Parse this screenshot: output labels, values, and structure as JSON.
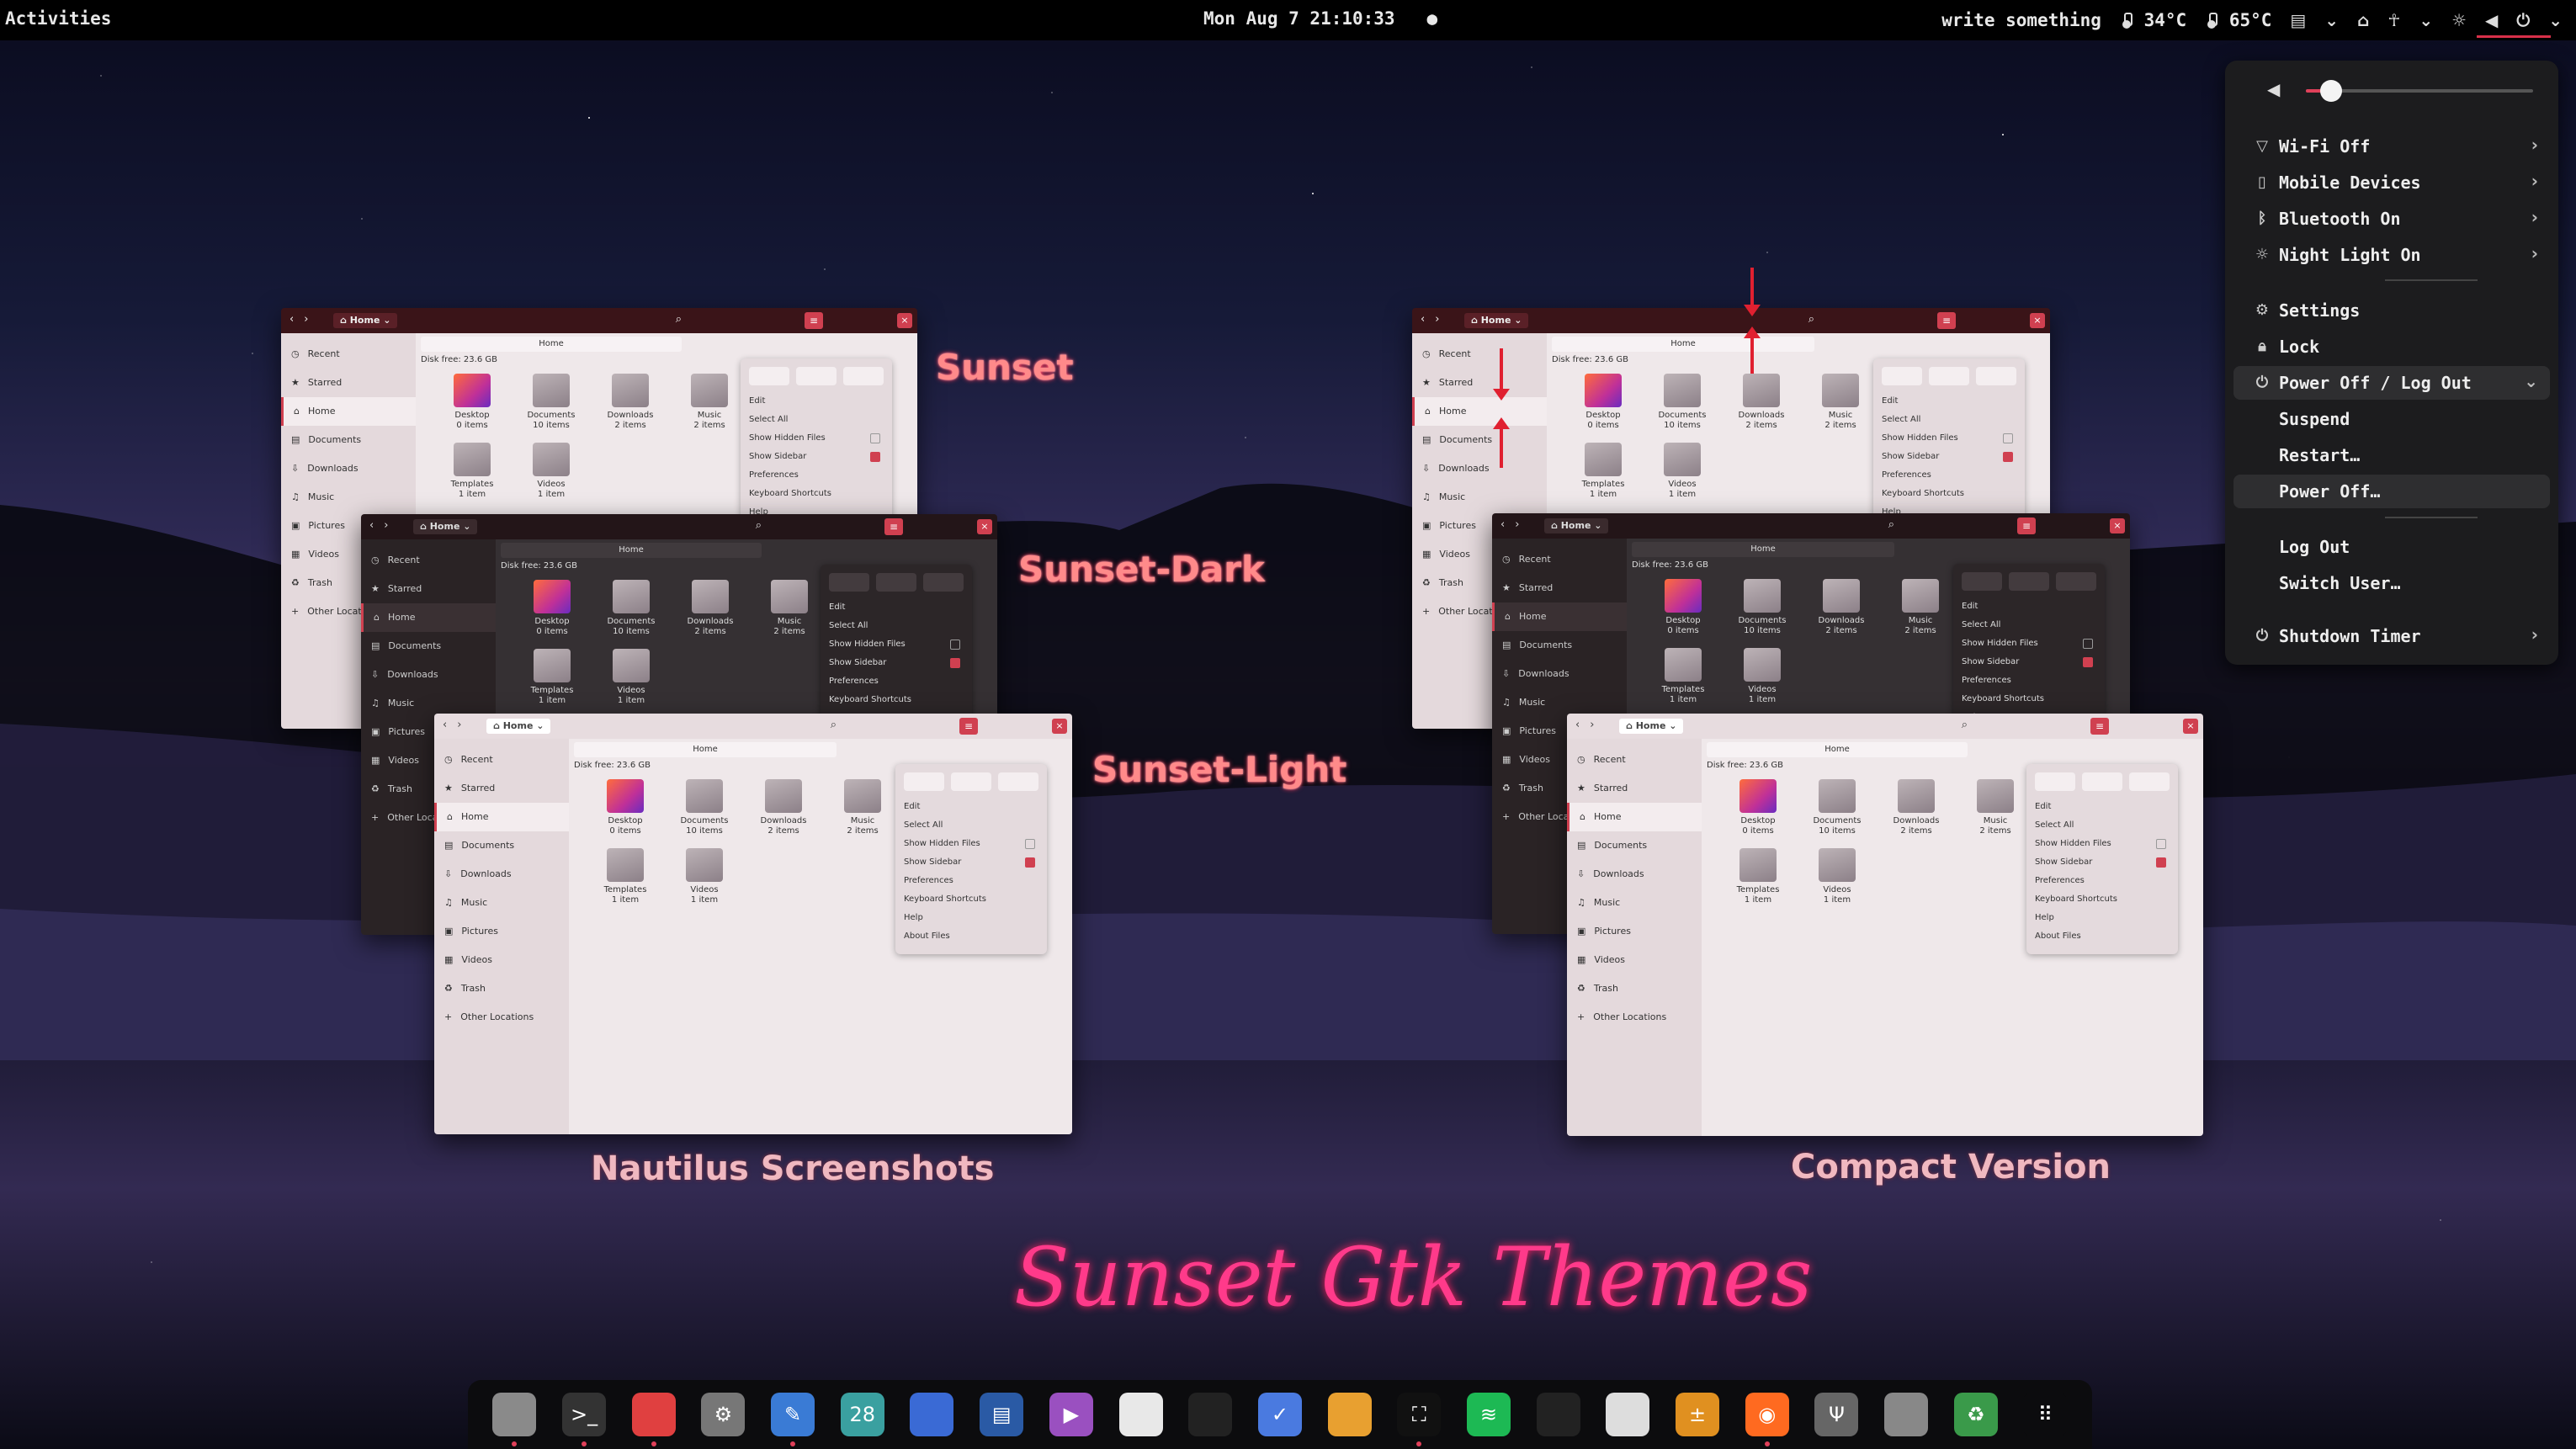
{
  "topbar": {
    "activities": "Activities",
    "clock": "Mon Aug 7 21:10:33",
    "notification_dot": "●",
    "input_text": "write something",
    "temp1": "34°C",
    "temp2": "65°C"
  },
  "quick_menu": {
    "volume_fraction": 0.11,
    "wifi": "Wi-Fi Off",
    "mobile": "Mobile Devices",
    "bluetooth": "Bluetooth On",
    "night_light": "Night Light On",
    "settings": "Settings",
    "lock": "Lock",
    "power_header": "Power Off / Log Out",
    "suspend": "Suspend",
    "restart": "Restart…",
    "power_off": "Power Off…",
    "log_out": "Log Out",
    "switch_user": "Switch User…",
    "shutdown_timer": "Shutdown Timer"
  },
  "labels": {
    "sunset": "Sunset",
    "sunset_dark": "Sunset-Dark",
    "sunset_light": "Sunset-Light",
    "nautilus": "Nautilus Screenshots",
    "compact": "Compact Version",
    "brand": "Sunset Gtk Themes"
  },
  "nautilus": {
    "path": "Home",
    "tab": "Home",
    "disk": "Disk free: 23.6 GB",
    "sidebar": [
      "Recent",
      "Starred",
      "Home",
      "Documents",
      "Downloads",
      "Music",
      "Pictures",
      "Videos",
      "Trash",
      "Other Locations"
    ],
    "files": [
      {
        "name": "Desktop",
        "count": "0 items"
      },
      {
        "name": "Documents",
        "count": "10 items"
      },
      {
        "name": "Downloads",
        "count": "2 items"
      },
      {
        "name": "Music",
        "count": "2 items"
      },
      {
        "name": "Templates",
        "count": "1 item"
      },
      {
        "name": "Videos",
        "count": "1 item"
      }
    ],
    "popover": {
      "edit": "Edit",
      "select_all": "Select All",
      "show_hidden": "Show Hidden Files",
      "show_sidebar": "Show Sidebar",
      "preferences": "Preferences",
      "shortcuts": "Keyboard Shortcuts",
      "help": "Help",
      "about": "About Files"
    }
  },
  "dock": {
    "apps": [
      "files",
      "terminal",
      "software",
      "settings",
      "text-editor",
      "calendar",
      "screenshot",
      "document",
      "video",
      "store",
      "paint",
      "tasks",
      "chrome",
      "window",
      "spotify",
      "inkscape",
      "image-viewer",
      "calculator",
      "firefox",
      "usb",
      "drive",
      "trash",
      "app-grid"
    ],
    "calendar_day": "28"
  }
}
